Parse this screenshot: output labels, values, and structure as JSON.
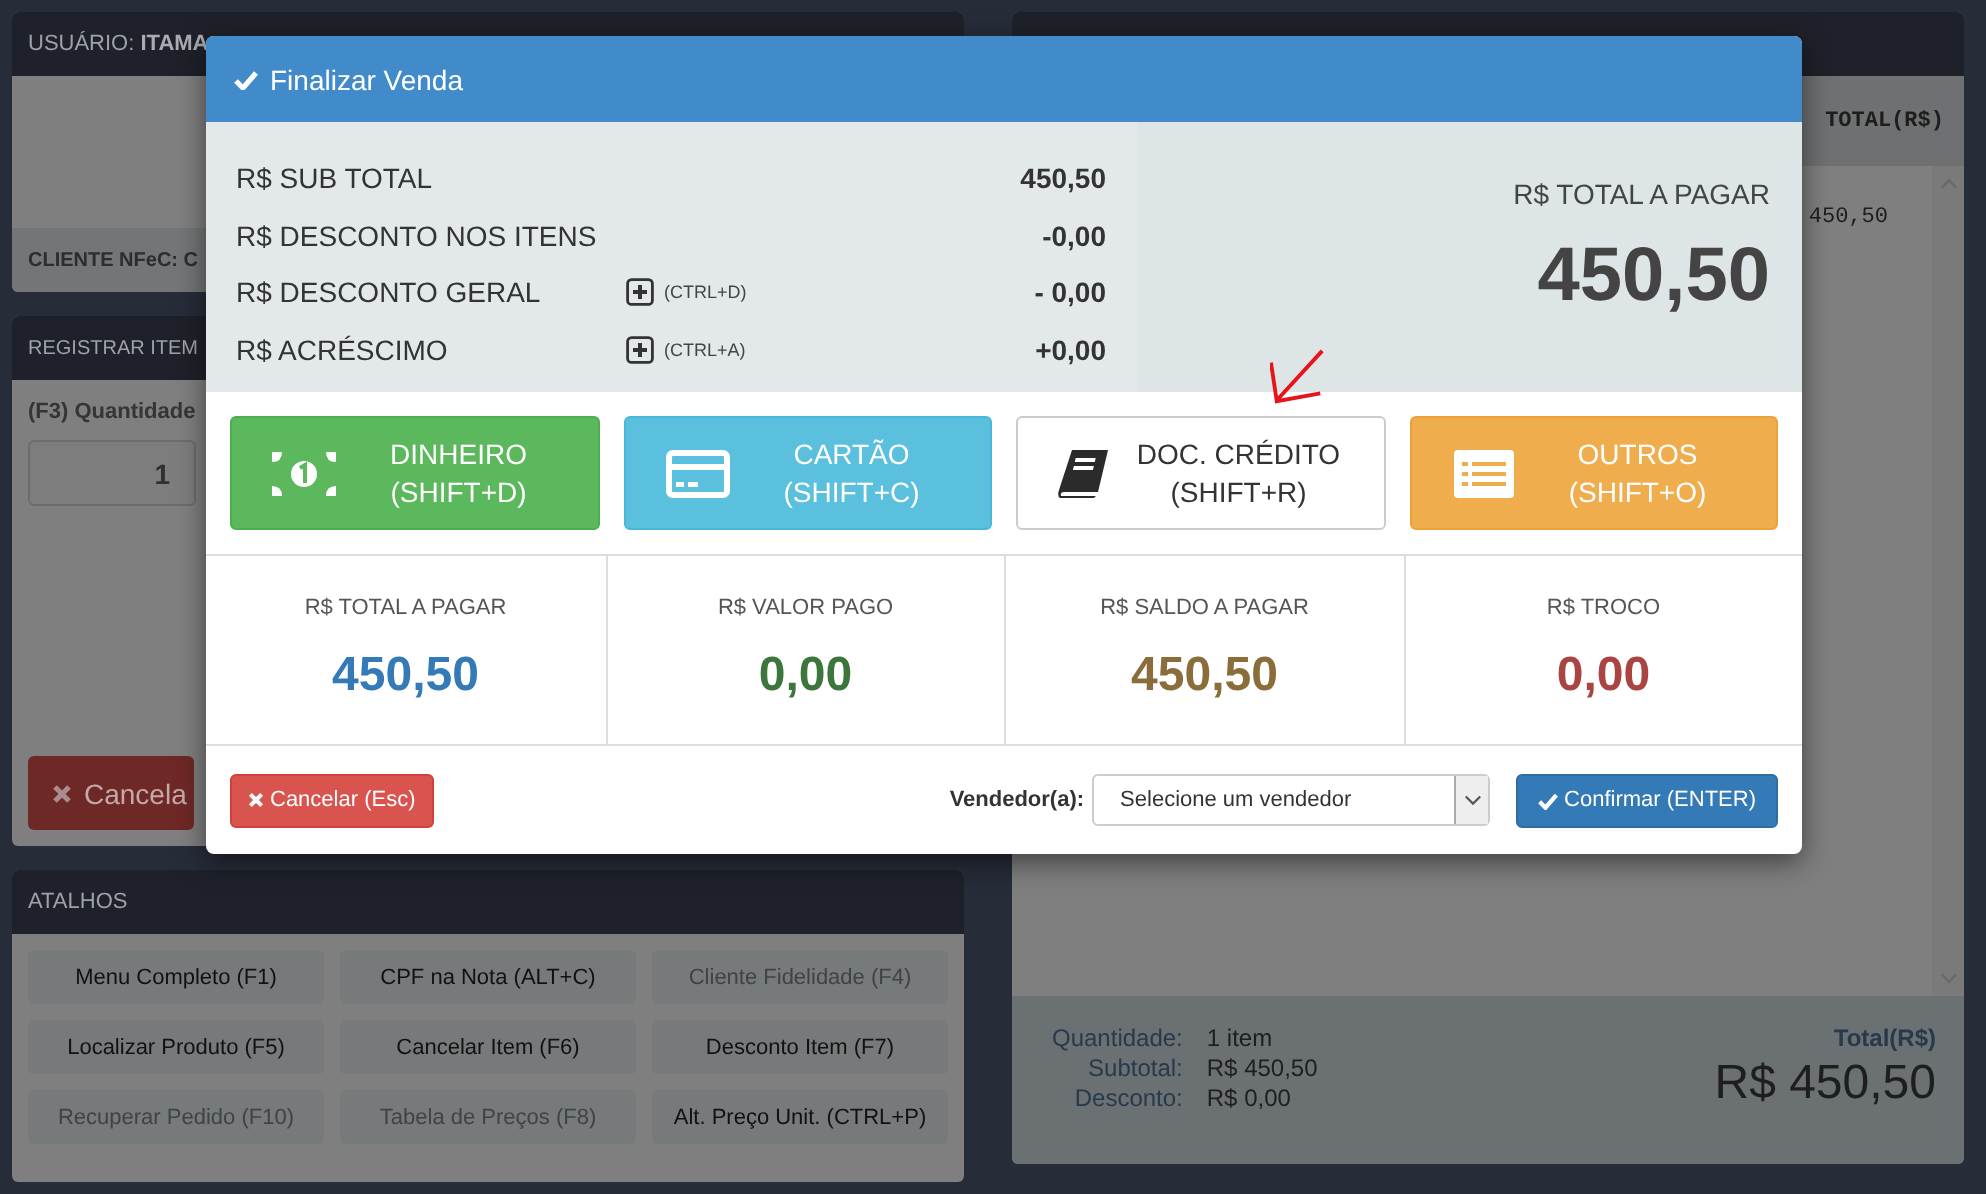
{
  "user_panel": {
    "label": "USUÁRIO:",
    "user": "ITAMA",
    "client": "CLIENTE NFeC: C"
  },
  "register_panel": {
    "title": "REGISTRAR ITEM",
    "quantity_label": "(F3) Quantidade",
    "quantity": "1",
    "cancel_button": "Cancela"
  },
  "shortcuts_panel": {
    "title": "ATALHOS",
    "buttons": [
      {
        "label": "Menu Completo (F1)",
        "disabled": false
      },
      {
        "label": "CPF na Nota (ALT+C)",
        "disabled": false
      },
      {
        "label": "Cliente Fidelidade (F4)",
        "disabled": true
      },
      {
        "label": "Localizar Produto (F5)",
        "disabled": false
      },
      {
        "label": "Cancelar Item (F6)",
        "disabled": false
      },
      {
        "label": "Desconto Item (F7)",
        "disabled": false
      },
      {
        "label": "Recuperar Pedido (F10)",
        "disabled": true
      },
      {
        "label": "Tabela de Preços (F8)",
        "disabled": true
      },
      {
        "label": "Alt. Preço Unit. (CTRL+P)",
        "disabled": false
      }
    ]
  },
  "products_panel": {
    "columns": [
      "TOTAL(R$)"
    ],
    "rows": [
      {
        "column_2": "450,50"
      }
    ],
    "summary": [
      {
        "label": "Quantidade:",
        "value": "1 item"
      },
      {
        "label": "Subtotal:",
        "value": "R$ 450,50"
      },
      {
        "label": "Desconto:",
        "value": "R$ 0,00"
      }
    ],
    "total_label": "Total(R$)",
    "total": "R$ 450,50"
  },
  "dialog": {
    "title": "Finalizar Venda",
    "lines": [
      {
        "label": "R$ SUB TOTAL",
        "value": "450,50"
      },
      {
        "label": "R$ DESCONTO NOS ITENS",
        "value": "-0,00"
      },
      {
        "label": "R$ DESCONTO GERAL",
        "shortcut": "(CTRL+D)",
        "value": "- 0,00"
      },
      {
        "label": "R$ ACRÉSCIMO",
        "shortcut": "(CTRL+A)",
        "value": "+0,00"
      }
    ],
    "total_label": "R$ TOTAL A PAGAR",
    "total": "450,50",
    "payment_buttons": [
      {
        "kind": "cash",
        "label": "DINHEIRO",
        "shortcut": "(SHIFT+D)"
      },
      {
        "kind": "card",
        "label": "CARTÃO",
        "shortcut": "(SHIFT+C)"
      },
      {
        "kind": "credit",
        "label": "DOC. CRÉDITO",
        "shortcut": "(SHIFT+R)"
      },
      {
        "kind": "other",
        "label": "OUTROS",
        "shortcut": "(SHIFT+O)"
      }
    ],
    "stats": [
      {
        "label": "R$ TOTAL A PAGAR",
        "value": "450,50",
        "color": "#337ab7"
      },
      {
        "label": "R$ VALOR PAGO",
        "value": "0,00",
        "color": "#3c763d"
      },
      {
        "label": "R$ SALDO A PAGAR",
        "value": "450,50",
        "color": "#8a6d3b"
      },
      {
        "label": "R$ TROCO",
        "value": "0,00",
        "color": "#a94442"
      }
    ],
    "cancel_button": "Cancelar (Esc)",
    "seller_label": "Vendedor(a):",
    "seller_value": "Selecione um vendedor",
    "confirm_button": "Confirmar (ENTER)"
  }
}
